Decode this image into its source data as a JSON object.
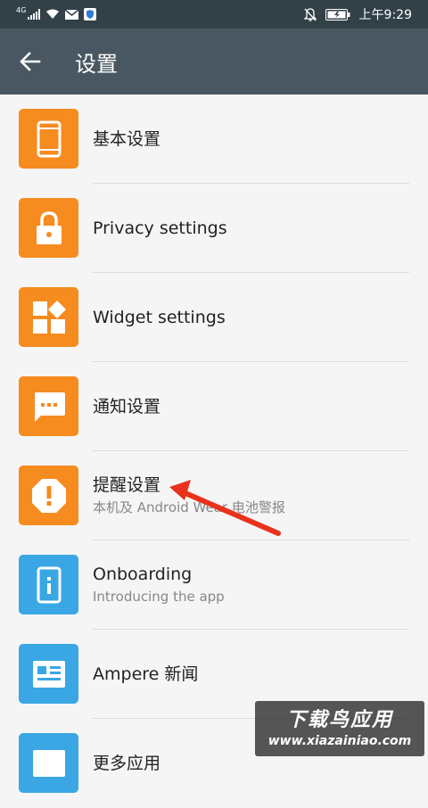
{
  "status_bar": {
    "network": "4G",
    "time": "上午9:29"
  },
  "app_bar": {
    "title": "设置"
  },
  "settings_items": [
    {
      "title": "基本设置",
      "subtitle": "",
      "icon": "phone-icon",
      "color": "#f68b1f"
    },
    {
      "title": "Privacy settings",
      "subtitle": "",
      "icon": "lock-icon",
      "color": "#f68b1f"
    },
    {
      "title": "Widget settings",
      "subtitle": "",
      "icon": "widgets-icon",
      "color": "#f68b1f"
    },
    {
      "title": "通知设置",
      "subtitle": "",
      "icon": "message-icon",
      "color": "#f68b1f"
    },
    {
      "title": "提醒设置",
      "subtitle": "本机及 Android Wear 电池警报",
      "icon": "alert-icon",
      "color": "#f68b1f"
    },
    {
      "title": "Onboarding",
      "subtitle": "Introducing the app",
      "icon": "info-phone-icon",
      "color": "#3aa7e4"
    },
    {
      "title": "Ampere 新闻",
      "subtitle": "",
      "icon": "news-icon",
      "color": "#3aa7e4"
    },
    {
      "title": "更多应用",
      "subtitle": "",
      "icon": "apps-icon",
      "color": "#3aa7e4"
    }
  ],
  "watermark": {
    "title": "下载鸟应用",
    "url": "www.xiazainiao.com"
  },
  "colors": {
    "status_bar": "#324048",
    "app_bar": "#485761",
    "orange_icon": "#f68b1f",
    "blue_icon": "#3aa7e4",
    "annotation_arrow": "#e8321e"
  }
}
